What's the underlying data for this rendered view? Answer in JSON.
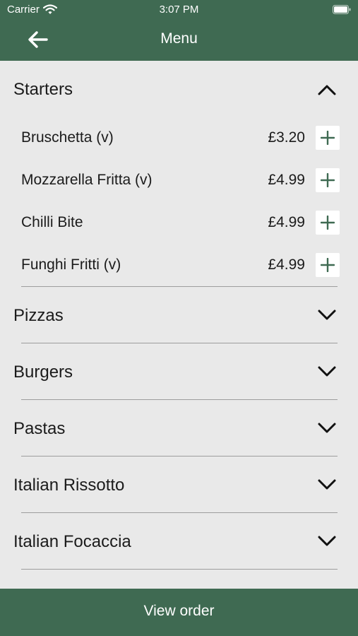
{
  "status_bar": {
    "carrier": "Carrier",
    "time": "3:07 PM",
    "icons": [
      "wifi-icon",
      "battery-icon"
    ]
  },
  "nav": {
    "title": "Menu",
    "back_icon": "arrow-left-icon"
  },
  "sections": [
    {
      "title": "Starters",
      "expanded": true,
      "items": [
        {
          "name": "Bruschetta (v)",
          "price": "£3.20"
        },
        {
          "name": "Mozzarella Fritta (v)",
          "price": "£4.99"
        },
        {
          "name": "Chilli Bite",
          "price": "£4.99"
        },
        {
          "name": "Funghi Fritti (v)",
          "price": "£4.99"
        }
      ]
    },
    {
      "title": "Pizzas",
      "expanded": false
    },
    {
      "title": "Burgers",
      "expanded": false
    },
    {
      "title": "Pastas",
      "expanded": false
    },
    {
      "title": "Italian Rissotto",
      "expanded": false
    },
    {
      "title": "Italian Focaccia",
      "expanded": false
    }
  ],
  "footer": {
    "button_label": "View order"
  },
  "colors": {
    "accent": "#3f6a52",
    "background": "#e9e9e9",
    "divider": "#9d9d9d"
  }
}
